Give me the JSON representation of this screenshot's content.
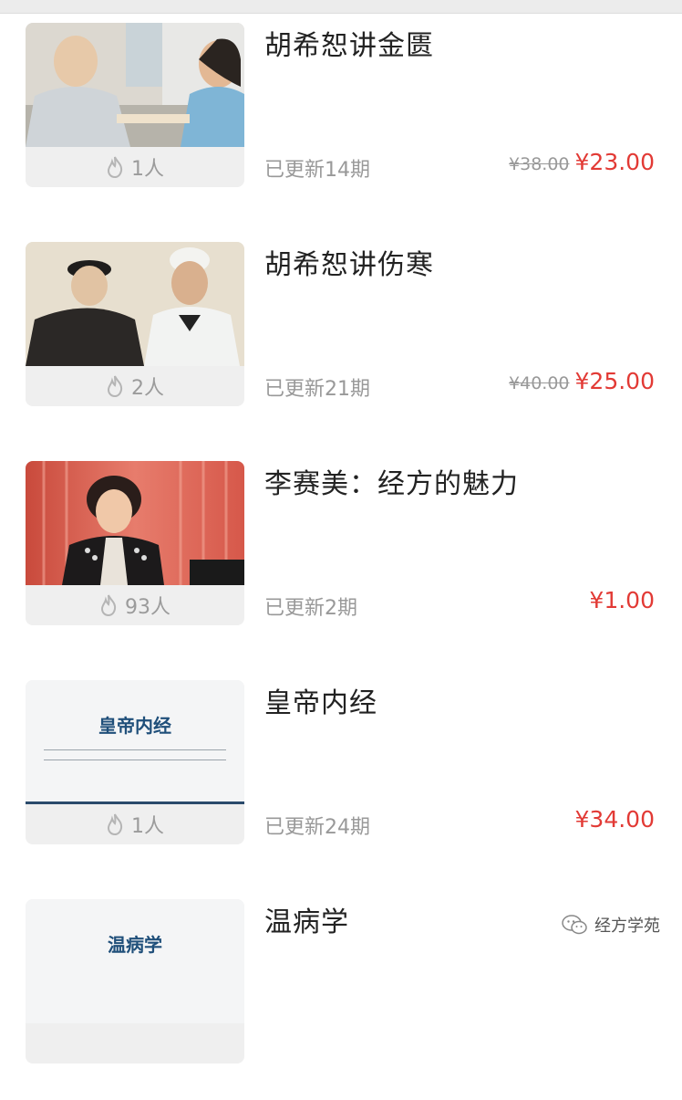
{
  "items": [
    {
      "title": "胡希恕讲金匮",
      "learners": "1人",
      "updated": "已更新14期",
      "old_price": "¥38.00",
      "price": "¥23.00"
    },
    {
      "title": "胡希恕讲伤寒",
      "learners": "2人",
      "updated": "已更新21期",
      "old_price": "¥40.00",
      "price": "¥25.00"
    },
    {
      "title": "李赛美：经方的魅力",
      "learners": "93人",
      "updated": "已更新2期",
      "old_price": "",
      "price": "¥1.00"
    },
    {
      "title": "皇帝内经",
      "learners": "1人",
      "updated": "已更新24期",
      "old_price": "",
      "price": "¥34.00",
      "thumb_text": "皇帝内经"
    },
    {
      "title": "温病学",
      "thumb_text": "温病学"
    }
  ],
  "watermark": {
    "text": "经方学苑",
    "icon": "wechat-icon"
  },
  "colors": {
    "price": "#e23a35",
    "muted": "#999999"
  }
}
